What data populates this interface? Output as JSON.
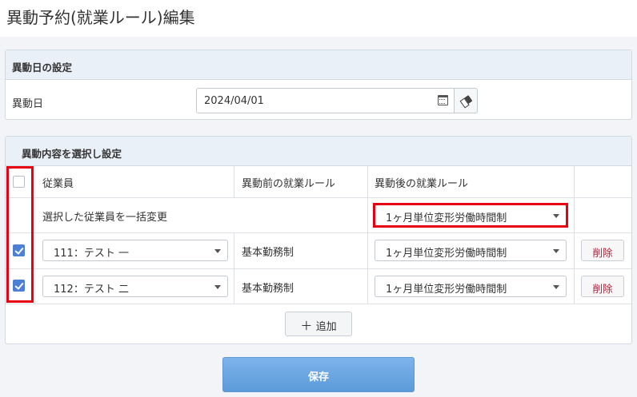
{
  "page": {
    "title": "異動予約(就業ルール)編集"
  },
  "date_panel": {
    "title": "異動日の設定",
    "date_label": "異動日",
    "date_value": "2024/04/01",
    "calendar_icon": "calendar-icon",
    "clear_icon": "eraser-icon"
  },
  "change_panel": {
    "title": "異動内容を選択し設定",
    "columns": [
      "従業員",
      "異動前の就業ルール",
      "異動後の就業ルール"
    ],
    "bulk_row": {
      "label": "選択した従業員を一括変更",
      "rule": "1ヶ月単位変形労働時間制"
    },
    "rows": [
      {
        "checked": true,
        "employee": "111：テスト 一",
        "before_rule": "基本勤務制",
        "after_rule": "1ヶ月単位変形労働時間制",
        "delete_label": "削除"
      },
      {
        "checked": true,
        "employee": "112：テスト 二",
        "before_rule": "基本勤務制",
        "after_rule": "1ヶ月単位変形労働時間制",
        "delete_label": "削除"
      }
    ],
    "add_label": "追加",
    "add_icon": "plus-icon"
  },
  "actions": {
    "save_label": "保存"
  },
  "colors": {
    "highlight": "#e60012",
    "accent": "#5b9ad9",
    "delete_text": "#b0233a"
  }
}
